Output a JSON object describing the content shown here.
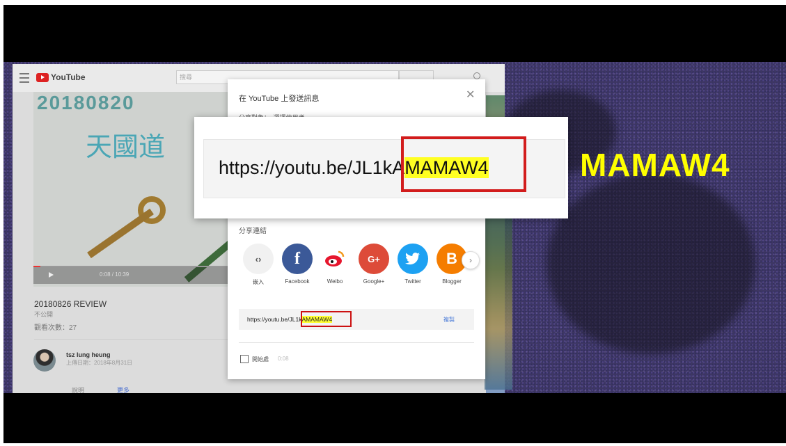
{
  "youtube": {
    "logo_text": "YouTube",
    "search_placeholder": "搜尋",
    "video": {
      "title_overlay": "20180820",
      "chinese_overlay": "天國道",
      "time": "0:08 / 10:39"
    },
    "video_title": "20180826 REVIEW",
    "uploader_sub": "不公開",
    "views": "觀看次數：27",
    "channel_name": "tsz lung heung",
    "upload_date": "上傳日期：2018年8月31日",
    "tab_left": "說明",
    "tab_right": "更多"
  },
  "modal": {
    "title": "在 YouTube 上發送訊息",
    "subtitle": "分享對象：　選擇使用者",
    "close_icon": "close-icon",
    "share_label": "分享連結",
    "share_targets": [
      {
        "label": "嵌入",
        "glyph": "<>",
        "color": "#f1f1f1",
        "text_color": "#555"
      },
      {
        "label": "Facebook",
        "glyph": "f",
        "color": "#3b5998",
        "text_color": "#fff"
      },
      {
        "label": "Weibo",
        "glyph": "微",
        "color": "#ffffff",
        "text_color": "#e6162d"
      },
      {
        "label": "Google+",
        "glyph": "G+",
        "color": "#dd4b39",
        "text_color": "#fff"
      },
      {
        "label": "Twitter",
        "glyph": "🐦",
        "color": "#1da1f2",
        "text_color": "#fff"
      },
      {
        "label": "Blogger",
        "glyph": "B",
        "color": "#f57d00",
        "text_color": "#fff"
      }
    ],
    "next_glyph": "›",
    "url_prefix": "https://youtu.be/JL1",
    "url_mid": "k",
    "url_highlight": "AMAMAW4",
    "copy_label": "複製",
    "start_label": "開始處",
    "start_time": "0:08"
  },
  "zoom": {
    "url_prefix": "https://youtu.be/JL1",
    "url_mid": "kA",
    "url_highlight": "MAMAW4"
  },
  "annotation": {
    "big_word": "MAMAW4",
    "highlight_color": "#ffff00",
    "box_color": "#d21c1c"
  }
}
